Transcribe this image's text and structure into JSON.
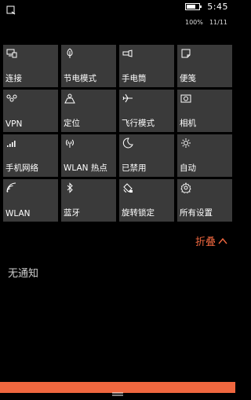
{
  "status_bar": {
    "left_icon": "notification-icon",
    "battery_icon": "battery-icon",
    "battery_level": 0.65,
    "time": "5:45",
    "battery_percent": "100%",
    "page_indicator": "11/11"
  },
  "quick_actions": [
    {
      "label": "连接",
      "icon": "connect-icon"
    },
    {
      "label": "节电模式",
      "icon": "battery-saver-icon"
    },
    {
      "label": "手电筒",
      "icon": "flashlight-icon"
    },
    {
      "label": "便笺",
      "icon": "note-icon"
    },
    {
      "label": "VPN",
      "icon": "vpn-icon"
    },
    {
      "label": "定位",
      "icon": "location-icon"
    },
    {
      "label": "飞行模式",
      "icon": "airplane-icon"
    },
    {
      "label": "相机",
      "icon": "camera-icon"
    },
    {
      "label": "手机网络",
      "icon": "cellular-icon"
    },
    {
      "label": "WLAN 热点",
      "icon": "hotspot-icon"
    },
    {
      "label": "已禁用",
      "icon": "moon-icon"
    },
    {
      "label": "自动",
      "icon": "brightness-icon"
    },
    {
      "label": "WLAN",
      "icon": "wifi-icon"
    },
    {
      "label": "蓝牙",
      "icon": "bluetooth-icon"
    },
    {
      "label": "旋转锁定",
      "icon": "rotation-lock-icon"
    },
    {
      "label": "所有设置",
      "icon": "gear-icon"
    }
  ],
  "collapse": {
    "label": "折叠",
    "icon": "chevron-up-icon"
  },
  "notifications": {
    "empty_text": "无通知"
  },
  "accent": "#f0673f"
}
